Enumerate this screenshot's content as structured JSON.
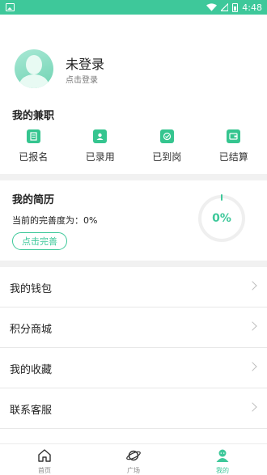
{
  "status_bar": {
    "time": "4:48"
  },
  "profile": {
    "name": "未登录",
    "login_hint": "点击登录"
  },
  "jobs": {
    "title": "我的兼职",
    "items": [
      {
        "label": "已报名",
        "icon": "document-icon"
      },
      {
        "label": "已录用",
        "icon": "id-card-icon"
      },
      {
        "label": "已到岗",
        "icon": "check-icon"
      },
      {
        "label": "已结算",
        "icon": "wallet-icon"
      }
    ]
  },
  "resume": {
    "title": "我的简历",
    "completeness_label": "当前的完善度为：0%",
    "completeness_value": 0,
    "ring_text": "0%",
    "button_label": "点击完善"
  },
  "menu": [
    {
      "label": "我的钱包"
    },
    {
      "label": "积分商城"
    },
    {
      "label": "我的收藏"
    },
    {
      "label": "联系客服"
    }
  ],
  "tabs": [
    {
      "label": "首页",
      "icon": "home-icon",
      "active": false
    },
    {
      "label": "广场",
      "icon": "planet-icon",
      "active": false
    },
    {
      "label": "我的",
      "icon": "profile-icon",
      "active": true
    }
  ],
  "colors": {
    "accent": "#3ec89a",
    "divider": "#f1f1f1"
  }
}
